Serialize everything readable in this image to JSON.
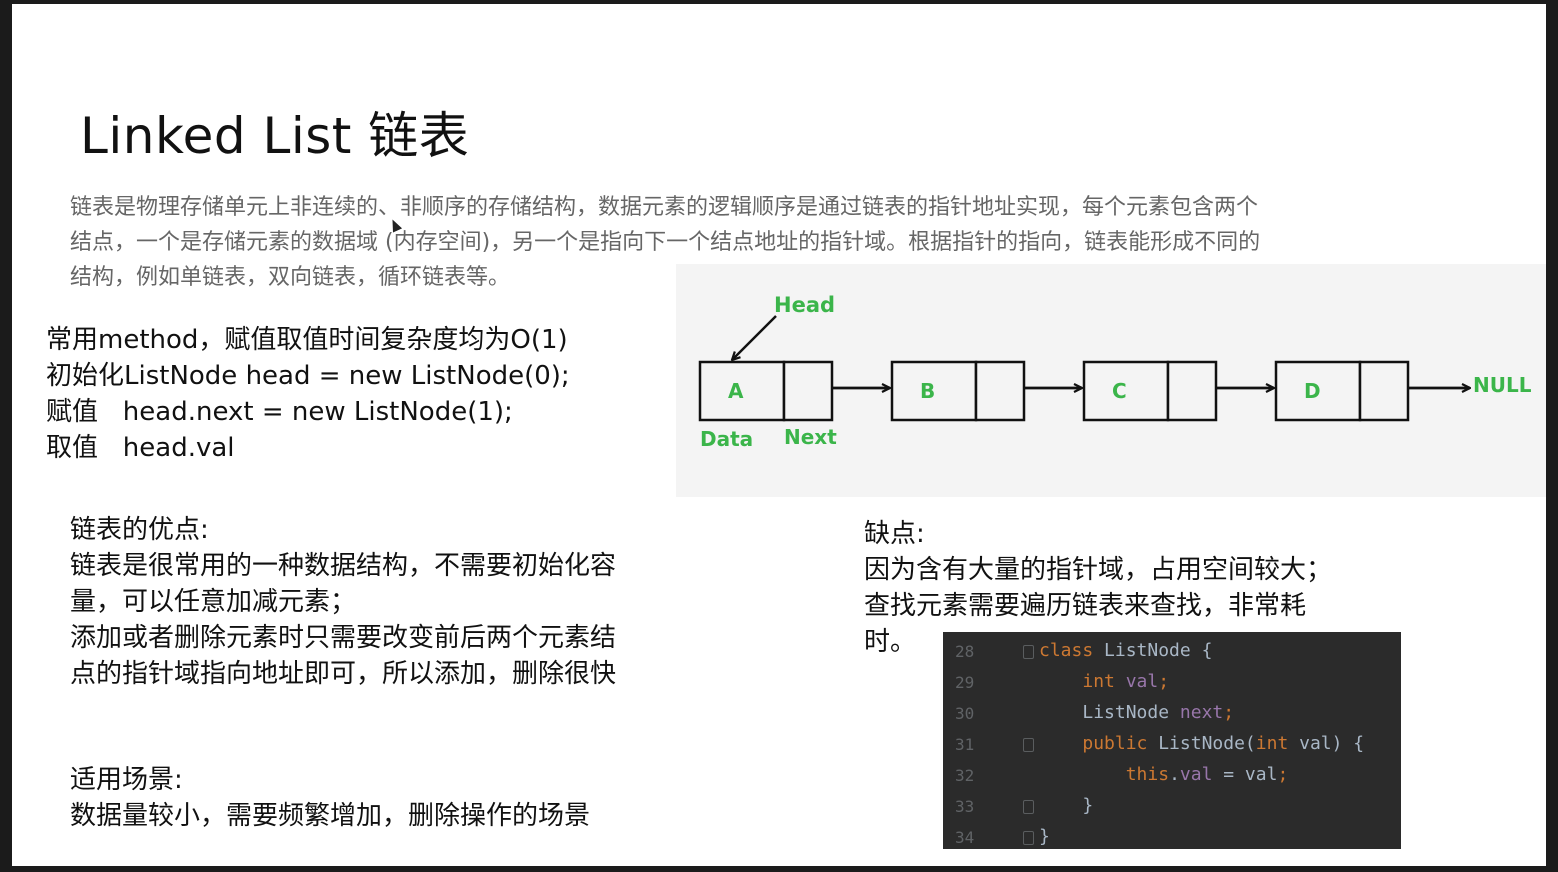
{
  "slide": {
    "title": "Linked List 链表",
    "intro_lines": [
      "链表是物理存储单元上非连续的、非顺序的存储结构，数据元素的逻辑顺序是通过链表的指针地址实现，每个元素包含两个",
      "结点，一个是存储元素的数据域 (内存空间)，另一个是指向下一个结点地址的指针域。根据指针的指向，链表能形成不同的",
      "结构，例如单链表，双向链表，循环链表等。"
    ],
    "methods_lines": [
      "常用method，赋值取值时间复杂度均为O(1)",
      "初始化ListNode head = new ListNode(0);",
      "赋值   head.next = new ListNode(1);",
      "取值   head.val"
    ],
    "pros_lines": [
      "链表的优点:",
      "链表是很常用的一种数据结构，不需要初始化容",
      "量，可以任意加减元素；",
      "添加或者删除元素时只需要改变前后两个元素结",
      "点的指针域指向地址即可，所以添加，删除很快"
    ],
    "cons_lines": [
      "缺点:",
      "因为含有大量的指针域，占用空间较大；",
      "查找元素需要遍历链表来查找，非常耗",
      "时。"
    ],
    "usage_lines": [
      "适用场景:",
      "数据量较小，需要频繁增加，删除操作的场景"
    ]
  },
  "diagram": {
    "head_label": "Head",
    "nodes": [
      "A",
      "B",
      "C",
      "D"
    ],
    "data_label": "Data",
    "next_label": "Next",
    "null_label": "NULL",
    "label_color": "#3bb54a"
  },
  "code": {
    "line_numbers": [
      "28",
      "29",
      "30",
      "31",
      "32",
      "33",
      "34"
    ],
    "lines": [
      [
        {
          "t": "class ",
          "c": "kw"
        },
        {
          "t": "ListNode {",
          "c": "plain"
        }
      ],
      [
        {
          "t": "    ",
          "c": "plain"
        },
        {
          "t": "int ",
          "c": "kw"
        },
        {
          "t": "val",
          "c": "fld"
        },
        {
          "t": ";",
          "c": "kw"
        }
      ],
      [
        {
          "t": "    ",
          "c": "plain"
        },
        {
          "t": "ListNode ",
          "c": "plain"
        },
        {
          "t": "next",
          "c": "fld"
        },
        {
          "t": ";",
          "c": "kw"
        }
      ],
      [
        {
          "t": "    ",
          "c": "plain"
        },
        {
          "t": "public ",
          "c": "kw"
        },
        {
          "t": "ListNode(",
          "c": "plain"
        },
        {
          "t": "int ",
          "c": "kw"
        },
        {
          "t": "val) {",
          "c": "plain"
        }
      ],
      [
        {
          "t": "        ",
          "c": "plain"
        },
        {
          "t": "this",
          "c": "kw"
        },
        {
          "t": ".",
          "c": "plain"
        },
        {
          "t": "val",
          "c": "fld"
        },
        {
          "t": " = val",
          "c": "plain"
        },
        {
          "t": ";",
          "c": "kw"
        }
      ],
      [
        {
          "t": "    }",
          "c": "plain"
        }
      ],
      [
        {
          "t": "}",
          "c": "plain"
        }
      ]
    ],
    "colors": {
      "background": "#2b2b2b",
      "keyword": "#cc7832",
      "field": "#9876aa",
      "text": "#a9b7c6"
    }
  }
}
